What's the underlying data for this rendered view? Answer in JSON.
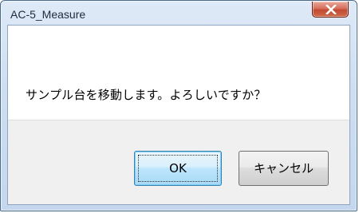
{
  "window": {
    "title": "AC-5_Measure"
  },
  "dialog": {
    "message": "サンプル台を移動します。よろしいですか？"
  },
  "buttons": {
    "ok_label": "OK",
    "cancel_label": "キャンセル"
  },
  "icons": {
    "close": "close-icon"
  },
  "colors": {
    "close_button": "#c94a32",
    "ok_button_border": "#3c7fb1",
    "button_area_bg": "#f0f0f0"
  }
}
